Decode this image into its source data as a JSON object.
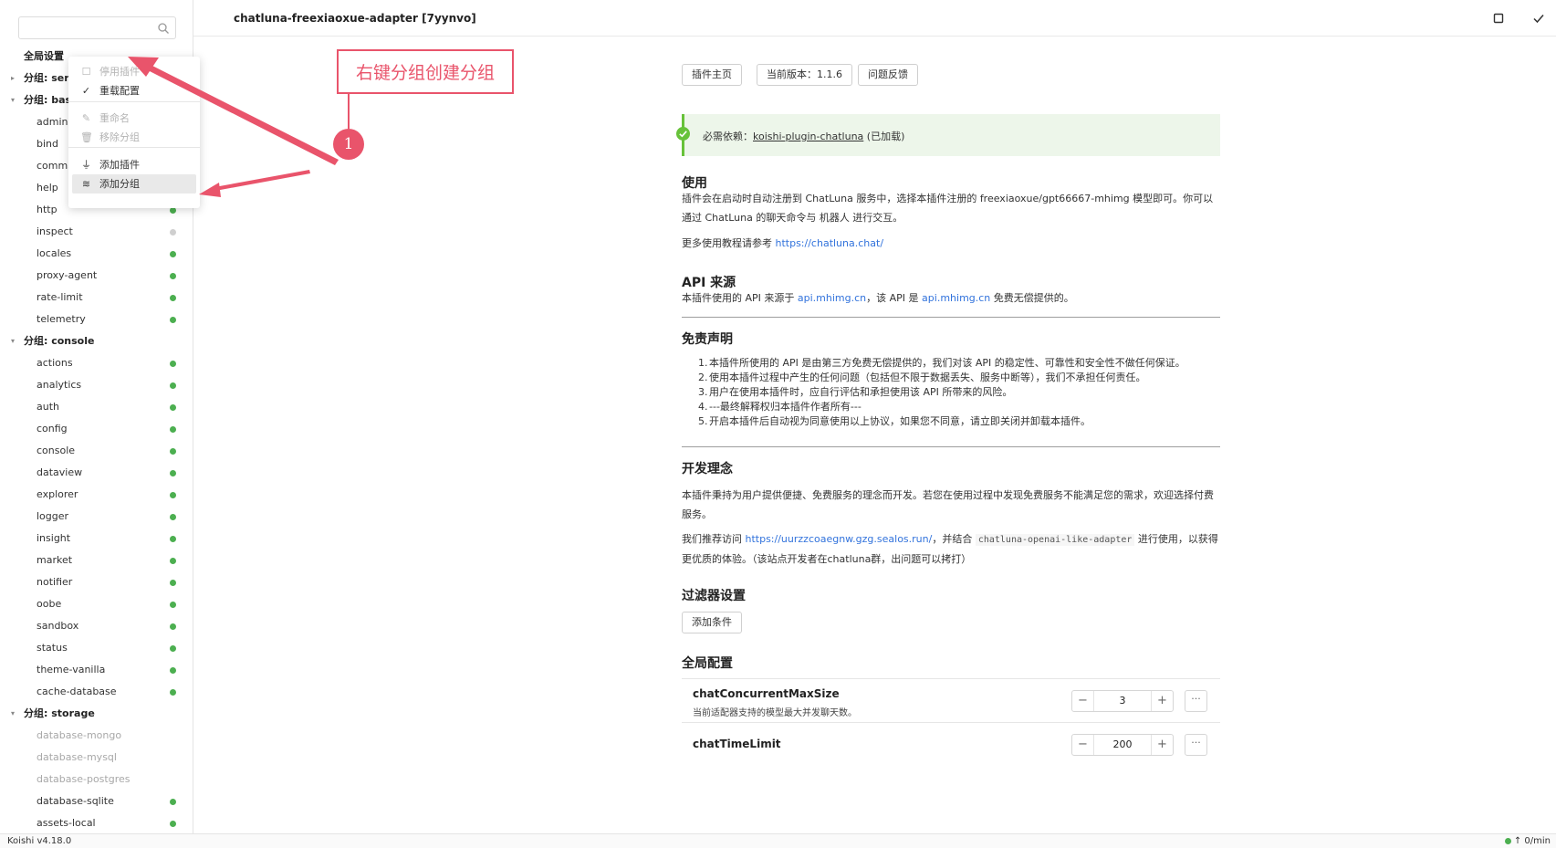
{
  "search": {
    "placeholder": ""
  },
  "sidebar": {
    "rows": [
      {
        "kind": "plain",
        "label": "全局设置"
      },
      {
        "kind": "group",
        "caret": "▸",
        "label": "分组: ser"
      },
      {
        "kind": "group",
        "caret": "▾",
        "label": "分组: bas"
      },
      {
        "kind": "plugin",
        "label": "admin",
        "status": ""
      },
      {
        "kind": "plugin",
        "label": "bind",
        "status": ""
      },
      {
        "kind": "plugin",
        "label": "comma",
        "status": ""
      },
      {
        "kind": "plugin",
        "label": "help",
        "status": ""
      },
      {
        "kind": "plugin",
        "label": "http",
        "status": "on"
      },
      {
        "kind": "plugin",
        "label": "inspect",
        "status": "off"
      },
      {
        "kind": "plugin",
        "label": "locales",
        "status": "on"
      },
      {
        "kind": "plugin",
        "label": "proxy-agent",
        "status": "on"
      },
      {
        "kind": "plugin",
        "label": "rate-limit",
        "status": "on"
      },
      {
        "kind": "plugin",
        "label": "telemetry",
        "status": "on"
      },
      {
        "kind": "group",
        "caret": "▾",
        "label": "分组: console"
      },
      {
        "kind": "plugin",
        "label": "actions",
        "status": "on"
      },
      {
        "kind": "plugin",
        "label": "analytics",
        "status": "on"
      },
      {
        "kind": "plugin",
        "label": "auth",
        "status": "on"
      },
      {
        "kind": "plugin",
        "label": "config",
        "status": "on"
      },
      {
        "kind": "plugin",
        "label": "console",
        "status": "on"
      },
      {
        "kind": "plugin",
        "label": "dataview",
        "status": "on"
      },
      {
        "kind": "plugin",
        "label": "explorer",
        "status": "on"
      },
      {
        "kind": "plugin",
        "label": "logger",
        "status": "on"
      },
      {
        "kind": "plugin",
        "label": "insight",
        "status": "on"
      },
      {
        "kind": "plugin",
        "label": "market",
        "status": "on"
      },
      {
        "kind": "plugin",
        "label": "notifier",
        "status": "on"
      },
      {
        "kind": "plugin",
        "label": "oobe",
        "status": "on"
      },
      {
        "kind": "plugin",
        "label": "sandbox",
        "status": "on"
      },
      {
        "kind": "plugin",
        "label": "status",
        "status": "on"
      },
      {
        "kind": "plugin",
        "label": "theme-vanilla",
        "status": "on"
      },
      {
        "kind": "plugin",
        "label": "cache-database",
        "status": "on"
      },
      {
        "kind": "group",
        "caret": "▾",
        "label": "分组: storage"
      },
      {
        "kind": "plugin",
        "label": "database-mongo",
        "status": "",
        "disabled": true
      },
      {
        "kind": "plugin",
        "label": "database-mysql",
        "status": "",
        "disabled": true
      },
      {
        "kind": "plugin",
        "label": "database-postgres",
        "status": "",
        "disabled": true
      },
      {
        "kind": "plugin",
        "label": "database-sqlite",
        "status": "on"
      },
      {
        "kind": "plugin",
        "label": "assets-local",
        "status": "on"
      }
    ]
  },
  "context_menu": {
    "items": [
      {
        "icon": "☐",
        "icon_name": "disable-icon",
        "label": "停用插件",
        "dim": true
      },
      {
        "icon": "✓",
        "icon_name": "check-icon",
        "label": "重载配置",
        "dim": false
      },
      {
        "icon": "✎",
        "icon_name": "rename-icon",
        "label": "重命名",
        "dim": true
      },
      {
        "icon": "🗑",
        "icon_name": "trash-icon",
        "label": "移除分组",
        "dim": true
      },
      {
        "icon": "⏚",
        "icon_name": "plug-icon",
        "label": "添加插件",
        "dim": false
      },
      {
        "icon": "≋",
        "icon_name": "layers-icon",
        "label": "添加分组",
        "dim": false,
        "hover": true
      }
    ]
  },
  "header": {
    "title": "chatluna-freexiaoxue-adapter [7yynvo]"
  },
  "toolbar": {
    "buttons": [
      {
        "name": "stop-button",
        "icon": "square-icon"
      },
      {
        "name": "save-button",
        "icon": "check-icon"
      },
      {
        "name": "edit-button",
        "icon": "edit-icon"
      }
    ]
  },
  "content": {
    "buttons": {
      "home": "插件主页",
      "version": "当前版本：1.1.6",
      "issues": "问题反馈"
    },
    "dependency": {
      "prefix": "必需依赖：",
      "name": "koishi-plugin-chatluna",
      "suffix": " (已加载)"
    },
    "usage": {
      "title": "使用",
      "p1": "插件会在启动时自动注册到 ChatLuna 服务中，选择本插件注册的 freexiaoxue/gpt66667-mhimg 模型即可。你可以通过 ChatLuna 的聊天命令与 机器人 进行交互。",
      "p2_prefix": "更多使用教程请参考 ",
      "p2_link": "https://chatluna.chat/"
    },
    "api": {
      "title": "API 来源",
      "p_a": "本插件使用的 API 来源于 ",
      "link1": "api.mhimg.cn",
      "p_b": "，该 API 是 ",
      "link2": "api.mhimg.cn",
      "p_c": " 免费无偿提供的。"
    },
    "disclaimer": {
      "title": "免责声明",
      "items": [
        "本插件所使用的 API 是由第三方免费无偿提供的，我们对该 API 的稳定性、可靠性和安全性不做任何保证。",
        "使用本插件过程中产生的任何问题（包括但不限于数据丢失、服务中断等），我们不承担任何责任。",
        "用户在使用本插件时，应自行评估和承担使用该 API 所带来的风险。",
        "---最终解释权归本插件作者所有---",
        "开启本插件后自动视为同意使用以上协议，如果您不同意，请立即关闭并卸载本插件。"
      ]
    },
    "philosophy": {
      "title": "开发理念",
      "p1": "本插件秉持为用户提供便捷、免费服务的理念而开发。若您在使用过程中发现免费服务不能满足您的需求，欢迎选择付费服务。",
      "p2_a": "我们推荐访问 ",
      "p2_link": "https://uurzzcoaegnw.gzg.sealos.run/",
      "p2_b": "，并结合 ",
      "p2_code": "chatluna-openai-like-adapter",
      "p2_c": " 进行使用，以获得更优质的体验。（该站点开发者在chatluna群，出问题可以拷打）"
    },
    "filter": {
      "title": "过滤器设置",
      "button": "添加条件"
    },
    "global": {
      "title": "全局配置",
      "fields": [
        {
          "name": "chatConcurrentMaxSize",
          "desc": "当前适配器支持的模型最大并发聊天数。",
          "value": "3"
        },
        {
          "name": "chatTimeLimit",
          "desc": "",
          "value": "200"
        }
      ],
      "more": "···"
    }
  },
  "status": {
    "version": "Koishi v4.18.0",
    "rate": "↑ 0/min"
  },
  "annotation": {
    "text": "右键分组创建分组",
    "number": "1",
    "color": "#e9546b"
  },
  "colors": {
    "active": "#4caf50",
    "inactive": "#cfcfcf",
    "link": "#3273dc",
    "success_bg": "#edf6ea",
    "accent": "#e9546b"
  }
}
